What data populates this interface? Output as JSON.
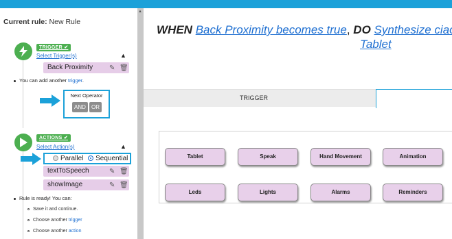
{
  "header": {
    "current_rule_label": "Current rule:",
    "current_rule_value": "New Rule"
  },
  "trigger": {
    "badge": "TRIGGER ✔",
    "select_link": "Select Trigger(s)",
    "items": [
      {
        "label": "Back Proximity"
      }
    ],
    "note_prefix": "You can add another",
    "note_link": "trigger",
    "note_suffix": ".",
    "next_operator_label": "Next Operator",
    "operators": [
      "AND",
      "OR"
    ]
  },
  "actions": {
    "badge": "ACTIONS ✔",
    "select_link": "Select Action(s)",
    "modes": [
      "Parallel",
      "Sequential"
    ],
    "selected_mode": "Sequential",
    "items": [
      {
        "label": "textToSpeech"
      },
      {
        "label": "showImage"
      }
    ],
    "ready_note": "Rule is ready! You can:",
    "options": [
      {
        "text": "Save it and continue.",
        "link": ""
      },
      {
        "text": "Choose another",
        "link": "trigger"
      },
      {
        "text": "Choose another",
        "link": "action"
      }
    ]
  },
  "rule_sentence": {
    "when": "WHEN",
    "trigger_text": "Back Proximity becomes true",
    "comma": ",",
    "do": "DO",
    "action_text": "Synthesize ciao",
    "action_text_line2": "Tablet"
  },
  "tabs": {
    "trigger": "TRIGGER",
    "actions": ""
  },
  "action_categories": [
    "Tablet",
    "Speak",
    "Hand Movement",
    "Animation",
    "Leds",
    "Lights",
    "Alarms",
    "Reminders"
  ],
  "colors": {
    "accent": "#1ba1d9",
    "success": "#4caf50",
    "item_bg": "#e6cde8",
    "link": "#1e6fd1"
  }
}
